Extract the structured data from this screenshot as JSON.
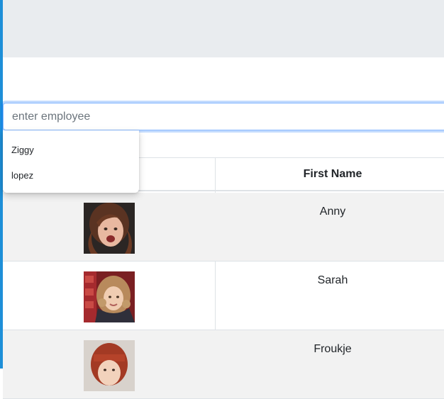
{
  "search": {
    "value": "",
    "placeholder": "enter employee"
  },
  "autocomplete": {
    "options": [
      "Ziggy",
      "lopez"
    ]
  },
  "table": {
    "columns": [
      "",
      "First Name"
    ],
    "rows": [
      {
        "photo": "avatar-photo",
        "first_name": "Anny"
      },
      {
        "photo": "avatar-photo",
        "first_name": "Sarah"
      },
      {
        "photo": "avatar-photo",
        "first_name": "Froukje"
      }
    ]
  },
  "colors": {
    "accent": "#1e8fd8",
    "header_band": "#e9ecef",
    "focus_border": "#86b7fe",
    "row_stripe": "#f2f2f2"
  }
}
